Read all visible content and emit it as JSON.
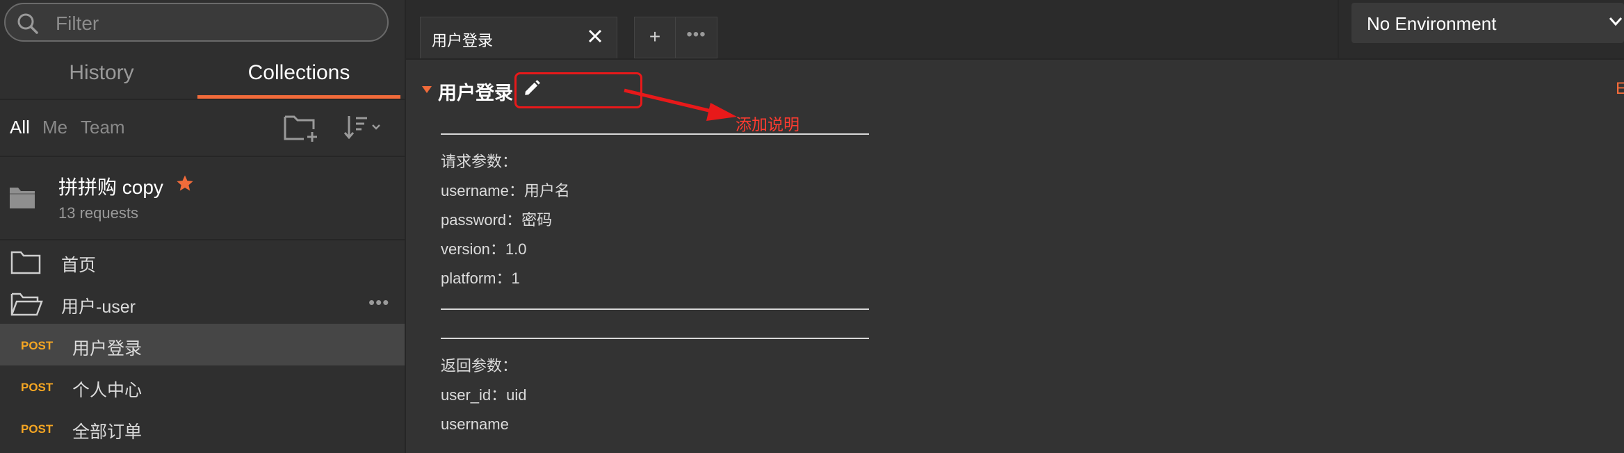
{
  "sidebar": {
    "filter_placeholder": "Filter",
    "tabs": {
      "history": "History",
      "collections": "Collections"
    },
    "chips": {
      "all": "All",
      "me": "Me",
      "team": "Team"
    },
    "collection": {
      "name": "拼拼购 copy",
      "count": "13 requests",
      "starred": true
    },
    "folders": [
      {
        "label": "首页"
      },
      {
        "label": "用户-user"
      }
    ],
    "requests": [
      {
        "method": "POST",
        "label": "用户登录",
        "selected": true
      },
      {
        "method": "POST",
        "label": "个人中心",
        "selected": false
      },
      {
        "method": "POST",
        "label": "全部订单",
        "selected": false
      }
    ]
  },
  "tabbar": {
    "active_tab": "用户登录",
    "add_label": "+",
    "more_label": "•••"
  },
  "environment": {
    "label": "No Environment"
  },
  "request": {
    "title": "用户登录",
    "edge_label": "E"
  },
  "annotation": {
    "text": "添加说明",
    "color": "#ff3b30"
  },
  "description": {
    "lines": [
      "",
      "请求参数：",
      "username：用户名",
      "password：密码",
      "version：1.0",
      "platform：1",
      "",
      "",
      "返回参数：",
      "user_id：uid",
      "username"
    ]
  },
  "colors": {
    "accent": "#f26b3a",
    "method_post": "#f5a623",
    "star": "#f26b3a"
  }
}
